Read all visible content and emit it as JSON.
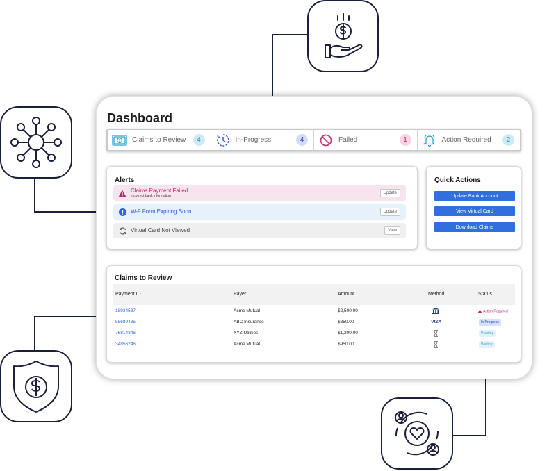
{
  "dashboard": {
    "title": "Dashboard",
    "stats": [
      {
        "label": "Claims to Review",
        "count": "4",
        "icon": "dollar-bill-icon",
        "color": "#2fa0cf",
        "badge_bg": "#cfeaf5",
        "badge_fg": "#2a8fb8"
      },
      {
        "label": "In-Progress",
        "count": "4",
        "icon": "clock-progress-icon",
        "color": "#3d5fd6",
        "badge_bg": "#d2dbf7",
        "badge_fg": "#3050c0"
      },
      {
        "label": "Failed",
        "count": "1",
        "icon": "prohibited-icon",
        "color": "#c23b7a",
        "badge_bg": "#f7d3e4",
        "badge_fg": "#b02c6a"
      },
      {
        "label": "Action Required",
        "count": "2",
        "icon": "bell-icon",
        "color": "#2fa0cf",
        "badge_bg": "#cfeaf5",
        "badge_fg": "#2a8fb8"
      }
    ],
    "alerts": {
      "title": "Alerts",
      "items": [
        {
          "title": "Claims Payment Failed",
          "subtitle": "Incorrect bank information",
          "action": "Update",
          "icon": "warning-triangle-icon",
          "bg": "#f8e4ee",
          "fg": "#c0246a"
        },
        {
          "title": "W-9 Form Expiring Soon",
          "subtitle": "",
          "action": "Update",
          "icon": "info-circle-icon",
          "bg": "#e6f1fb",
          "fg": "#2d62d8"
        },
        {
          "title": "Virtual Card Not Viewed",
          "subtitle": "",
          "action": "View",
          "icon": "refresh-icon",
          "bg": "#efefef",
          "fg": "#444444"
        }
      ]
    },
    "quick_actions": {
      "title": "Quick Actions",
      "buttons": [
        "Update Bank Account",
        "View Virtual Card",
        "Download Claims"
      ]
    },
    "claims": {
      "title": "Claims to Review",
      "columns": [
        "Payment ID",
        "Payer",
        "Amount",
        "Method",
        "Status"
      ],
      "rows": [
        {
          "id": "18934537",
          "payer": "Acme Mutual",
          "amount": "$2,500.00",
          "method": "bank-icon",
          "status": "Action Required",
          "status_kind": "action"
        },
        {
          "id": "58689435",
          "payer": "ABC Insurance",
          "amount": "$850.00",
          "method": "visa-logo",
          "method_text": "VISA",
          "status": "In Progress",
          "status_kind": "progress"
        },
        {
          "id": "76814346",
          "payer": "XYZ Utilities",
          "amount": "$1,200.00",
          "method": "hourglass-icon",
          "status": "Pending",
          "status_kind": "pending"
        },
        {
          "id": "34856246",
          "payer": "Acme Mutual",
          "amount": "$950.00",
          "method": "hourglass-icon",
          "status": "Waiting",
          "status_kind": "waiting"
        }
      ]
    }
  },
  "decor": {
    "line_color": "#1a1f3a",
    "tiles": [
      "hand-dollar-icon",
      "network-hub-icon",
      "shield-dollar-icon",
      "heart-people-cycle-icon"
    ]
  }
}
